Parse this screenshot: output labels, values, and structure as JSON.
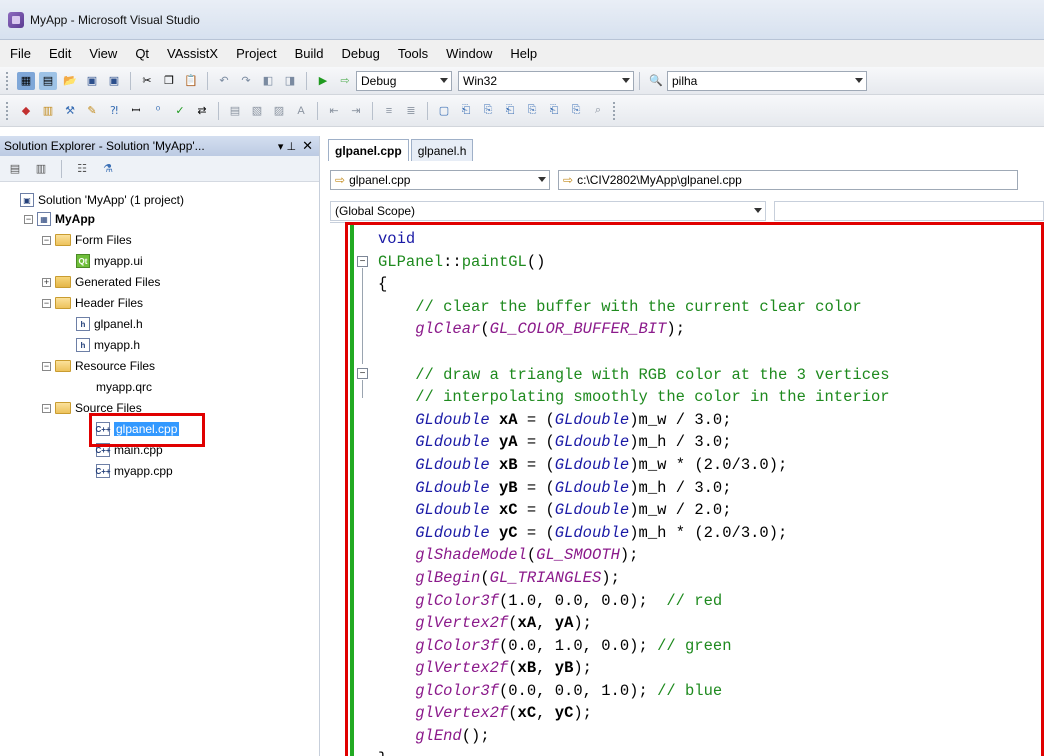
{
  "window": {
    "title": "MyApp - Microsoft Visual Studio"
  },
  "menu": [
    "File",
    "Edit",
    "View",
    "Qt",
    "VAssistX",
    "Project",
    "Build",
    "Debug",
    "Tools",
    "Window",
    "Help"
  ],
  "toolbar": {
    "config": "Debug",
    "platform": "Win32",
    "find_text": "pilha"
  },
  "solution_explorer": {
    "header": "Solution Explorer - Solution 'MyApp'...",
    "root": "Solution 'MyApp' (1 project)",
    "project": "MyApp",
    "folders": {
      "form": "Form Files",
      "generated": "Generated Files",
      "header": "Header Files",
      "resource": "Resource Files",
      "source": "Source Files"
    },
    "files": {
      "myapp_ui": "myapp.ui",
      "glpanel_h": "glpanel.h",
      "myapp_h": "myapp.h",
      "myapp_qrc": "myapp.qrc",
      "glpanel_cpp": "glpanel.cpp",
      "main_cpp": "main.cpp",
      "myapp_cpp": "myapp.cpp"
    }
  },
  "editor": {
    "tabs": [
      "glpanel.cpp",
      "glpanel.h"
    ],
    "nav_file": "glpanel.cpp",
    "nav_path": "c:\\CIV2802\\MyApp\\glpanel.cpp",
    "scope": "(Global Scope)"
  },
  "code": {
    "l1": "void",
    "l2a": "GLPanel",
    "l2b": "::",
    "l2c": "paintGL",
    "l2d": "()",
    "l3": "{",
    "l4": "// clear the buffer with the current clear color",
    "l5a": "glClear",
    "l5b": "GL_COLOR_BUFFER_BIT",
    "l7": "// draw a triangle with RGB color at the 3 vertices",
    "l8": "// interpolating smoothly the color in the interior",
    "gldouble": "GLdouble",
    "xA": "xA",
    "yA": "yA",
    "xB": "xB",
    "yB": "yB",
    "xC": "xC",
    "yC": "yC",
    "mw": "m_w",
    "mh": "m_h",
    "e1": " / 3.0;",
    "e2": " / 3.0;",
    "e3": " * (2.0/3.0);",
    "e4": " / 3.0;",
    "e5": " / 2.0;",
    "e6": " * (2.0/3.0);",
    "shade": "glShadeModel",
    "smooth": "GL_SMOOTH",
    "begin": "glBegin",
    "tri": "GL_TRIANGLES",
    "color": "glColor3f",
    "vertex": "glVertex2f",
    "c1": "(1.0, 0.0, 0.0);",
    "c1cm": "// red",
    "c2": "(0.0, 1.0, 0.0);",
    "c2cm": "// green",
    "c3": "(0.0, 0.0, 1.0);",
    "c3cm": "// blue",
    "end": "glEnd",
    "end2": "();",
    "close": "}"
  }
}
